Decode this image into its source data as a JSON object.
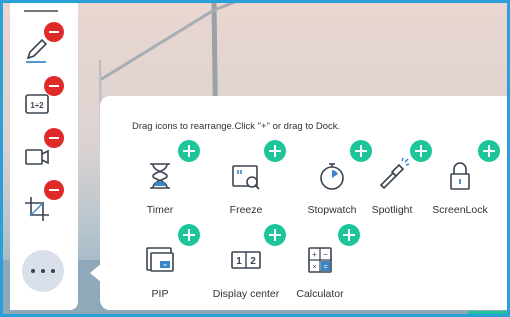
{
  "panel": {
    "hint": "Drag icons to rearrange.Click \"+\" or drag to Dock.",
    "tools": [
      {
        "label": "Timer",
        "icon": "hourglass-icon"
      },
      {
        "label": "Freeze",
        "icon": "freeze-magnifier-icon"
      },
      {
        "label": "Stopwatch",
        "icon": "stopwatch-icon"
      },
      {
        "label": "Spotlight",
        "icon": "flashlight-icon"
      },
      {
        "label": "ScreenLock",
        "icon": "padlock-icon"
      },
      {
        "label": "PIP",
        "icon": "picture-in-picture-icon"
      },
      {
        "label": "Display center",
        "icon": "display-center-icon"
      },
      {
        "label": "Calculator",
        "icon": "calculator-icon"
      }
    ]
  },
  "dock": {
    "items": [
      {
        "icon": "pen-icon"
      },
      {
        "icon": "split-screen-1-2-icon",
        "text": "1÷2"
      },
      {
        "icon": "video-camera-icon"
      },
      {
        "icon": "crop-icon"
      }
    ],
    "more_icon": "more-dots-icon"
  },
  "colors": {
    "accent_add": "#1fc59a",
    "remove": "#e02a2a",
    "frame": "#2a9fd8",
    "icon_line": "#3b4450",
    "icon_blue": "#3a86c9"
  }
}
